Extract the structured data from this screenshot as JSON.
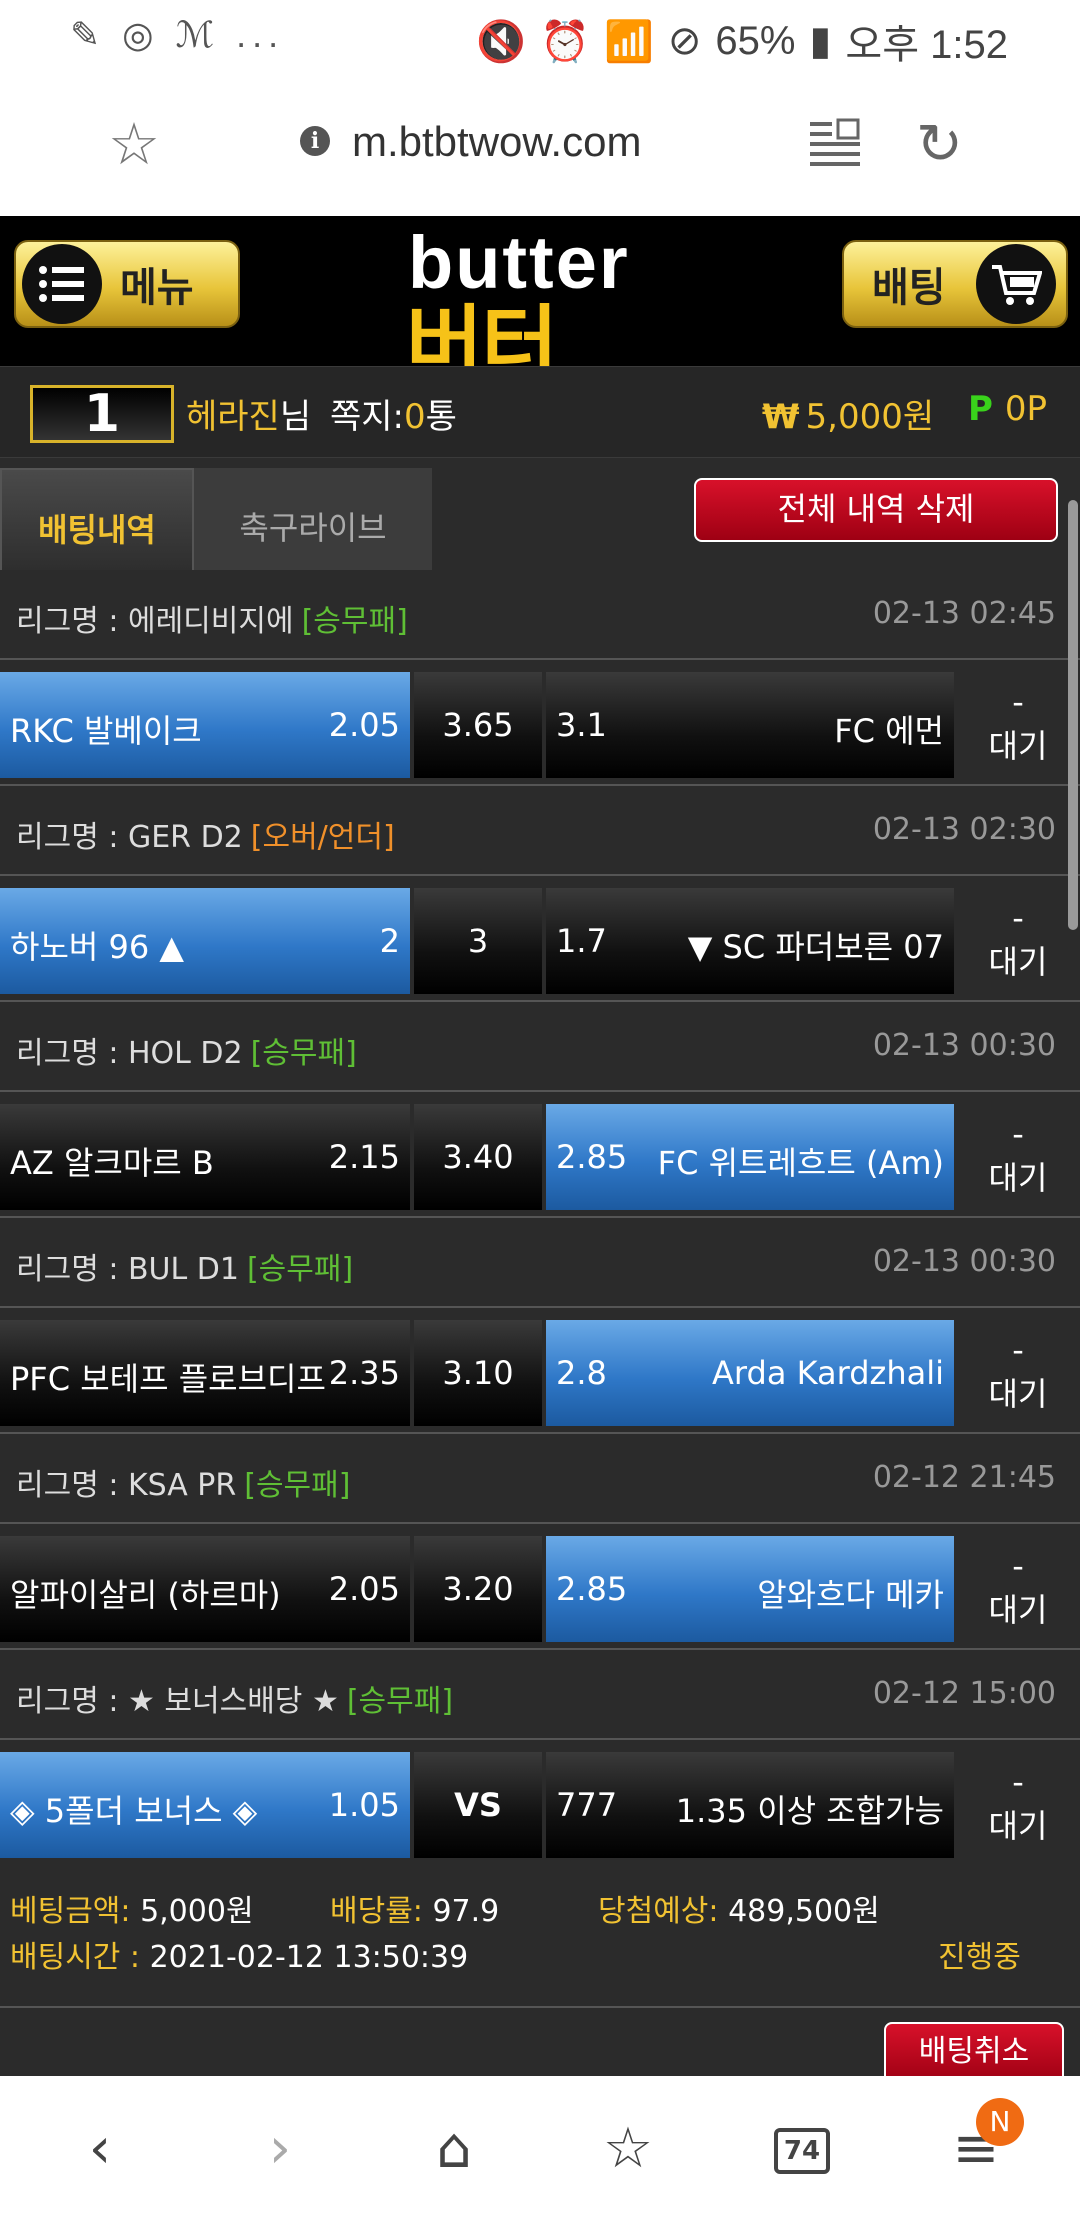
{
  "statusbar": {
    "left_icons": "✎ ◎ ℳ ...",
    "battery": "65%",
    "time": "오후 1:52"
  },
  "browser": {
    "url": "m.btbtwow.com"
  },
  "header": {
    "menu_label": "메뉴",
    "bet_label": "배팅",
    "logo_en": "butter",
    "logo_ko": "버터"
  },
  "user": {
    "level": "1",
    "name": "헤라진",
    "suffix": "님",
    "msg_label": "쪽지:",
    "msg_count": "0",
    "msg_unit": "통",
    "money_sign": "₩",
    "money": "5,000원",
    "point_sign": "P",
    "points": "0P"
  },
  "tabs": {
    "history": "배팅내역",
    "live": "축구라이브",
    "delete_all": "전체 내역 삭제"
  },
  "bets": [
    {
      "league": "리그명 : 에레디비지에",
      "type": "[승무패]",
      "type_color": "green",
      "time": "02-13 02:45",
      "home": "RKC 발베이크",
      "home_odd": "2.05",
      "draw": "3.65",
      "away_odd": "3.1",
      "away": "FC 에먼",
      "selected": "home",
      "status_top": "-",
      "status": "대기"
    },
    {
      "league": "리그명 : GER D2",
      "type": "[오버/언더]",
      "type_color": "orange",
      "time": "02-13 02:30",
      "home": "하노버 96 ▲",
      "home_odd": "2",
      "draw": "3",
      "away_odd": "1.7",
      "away": "▼ SC 파더보른 07",
      "selected": "home",
      "status_top": "-",
      "status": "대기"
    },
    {
      "league": "리그명 : HOL D2",
      "type": "[승무패]",
      "type_color": "green",
      "time": "02-13 00:30",
      "home": "AZ 알크마르 B",
      "home_odd": "2.15",
      "draw": "3.40",
      "away_odd": "2.85",
      "away": "FC 위트레흐트 (Am)",
      "selected": "away",
      "status_top": "-",
      "status": "대기"
    },
    {
      "league": "리그명 : BUL D1",
      "type": "[승무패]",
      "type_color": "green",
      "time": "02-13 00:30",
      "home": "PFC 보테프 플로브디프",
      "home_odd": "2.35",
      "draw": "3.10",
      "away_odd": "2.8",
      "away": "Arda Kardzhali",
      "selected": "away",
      "status_top": "-",
      "status": "대기"
    },
    {
      "league": "리그명 : KSA PR",
      "type": "[승무패]",
      "type_color": "green",
      "time": "02-12 21:45",
      "home": "알파이살리 (하르마)",
      "home_odd": "2.05",
      "draw": "3.20",
      "away_odd": "2.85",
      "away": "알와흐다 메카",
      "selected": "away",
      "status_top": "-",
      "status": "대기"
    },
    {
      "league": "리그명 : ★ 보너스배당 ★",
      "type": "[승무패]",
      "type_color": "green",
      "time": "02-12 15:00",
      "home": "◈ 5폴더 보너스 ◈",
      "home_odd": "1.05",
      "draw": "VS",
      "away_odd": "777",
      "away": "1.35 이상 조합가능",
      "selected": "home",
      "status_top": "-",
      "status": "대기"
    }
  ],
  "summary": {
    "amount_label": "베팅금액:",
    "amount": "5,000원",
    "rate_label": "배당률:",
    "rate": "97.9",
    "expect_label": "당첨예상:",
    "expect": "489,500원",
    "time_label": "배팅시간 :",
    "time": "2021-02-12 13:50:39",
    "progress": "진행중",
    "cancel": "배팅취소"
  },
  "bottomnav": {
    "tabs_count": "74",
    "badge": "N"
  }
}
